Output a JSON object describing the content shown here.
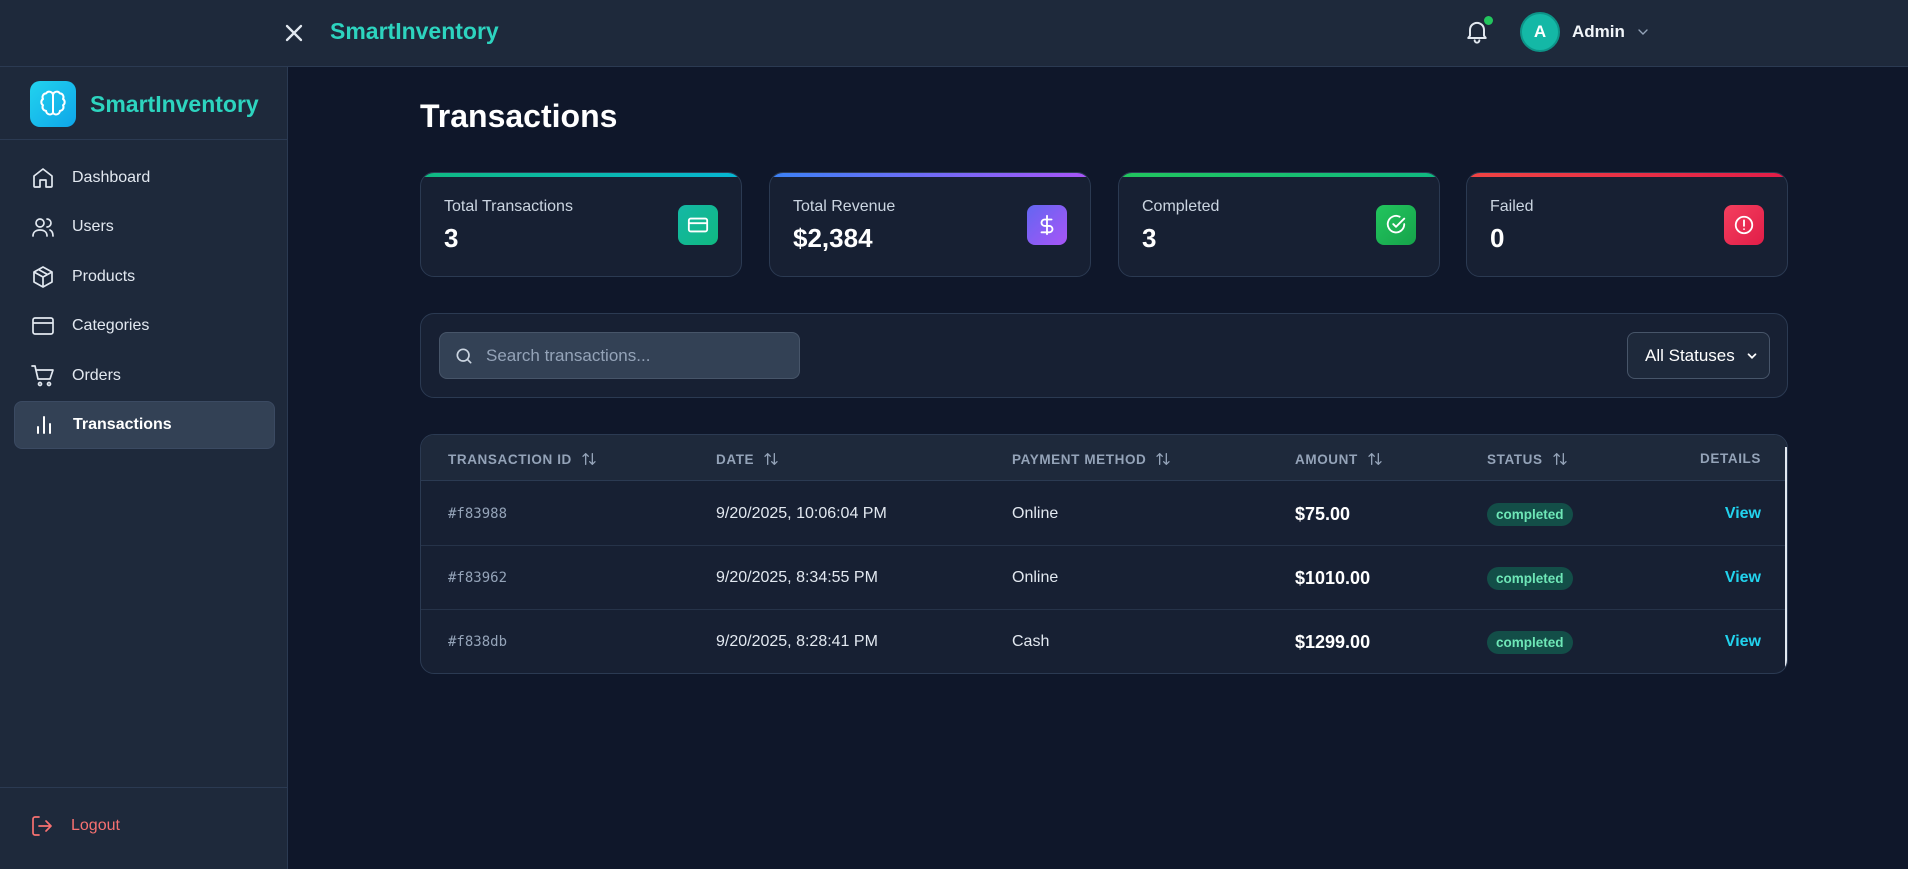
{
  "topbar": {
    "title": "SmartInventory",
    "user": {
      "initial": "A",
      "name": "Admin"
    },
    "notification_dot_color": "#22c55e"
  },
  "sidebar": {
    "brand": "SmartInventory",
    "items": [
      {
        "label": "Dashboard",
        "icon": "home-icon",
        "active": false
      },
      {
        "label": "Users",
        "icon": "users-icon",
        "active": false
      },
      {
        "label": "Products",
        "icon": "box-icon",
        "active": false
      },
      {
        "label": "Categories",
        "icon": "window-icon",
        "active": false
      },
      {
        "label": "Orders",
        "icon": "cart-icon",
        "active": false
      },
      {
        "label": "Transactions",
        "icon": "bar-chart-icon",
        "active": true
      }
    ],
    "logout_label": "Logout"
  },
  "page": {
    "title": "Transactions"
  },
  "stats": [
    {
      "label": "Total Transactions",
      "value": "3",
      "icon": "credit-card-icon",
      "color": "#14b8a6"
    },
    {
      "label": "Total Revenue",
      "value": "$2,384",
      "icon": "dollar-icon",
      "color": "#8b5cf6"
    },
    {
      "label": "Completed",
      "value": "3",
      "icon": "check-circle-icon",
      "color": "#22c55e"
    },
    {
      "label": "Failed",
      "value": "0",
      "icon": "alert-circle-icon",
      "color": "#f43f5e"
    }
  ],
  "filters": {
    "search_placeholder": "Search transactions...",
    "status_selected": "All Statuses"
  },
  "table": {
    "columns": [
      "TRANSACTION ID",
      "DATE",
      "PAYMENT METHOD",
      "AMOUNT",
      "STATUS",
      "DETAILS"
    ],
    "rows": [
      {
        "id": "#f83988",
        "date": "9/20/2025, 10:06:04 PM",
        "method": "Online",
        "amount": "$75.00",
        "status": "completed",
        "action": "View"
      },
      {
        "id": "#f83962",
        "date": "9/20/2025, 8:34:55 PM",
        "method": "Online",
        "amount": "$1010.00",
        "status": "completed",
        "action": "View"
      },
      {
        "id": "#f838db",
        "date": "9/20/2025, 8:28:41 PM",
        "method": "Cash",
        "amount": "$1299.00",
        "status": "completed",
        "action": "View"
      }
    ]
  }
}
